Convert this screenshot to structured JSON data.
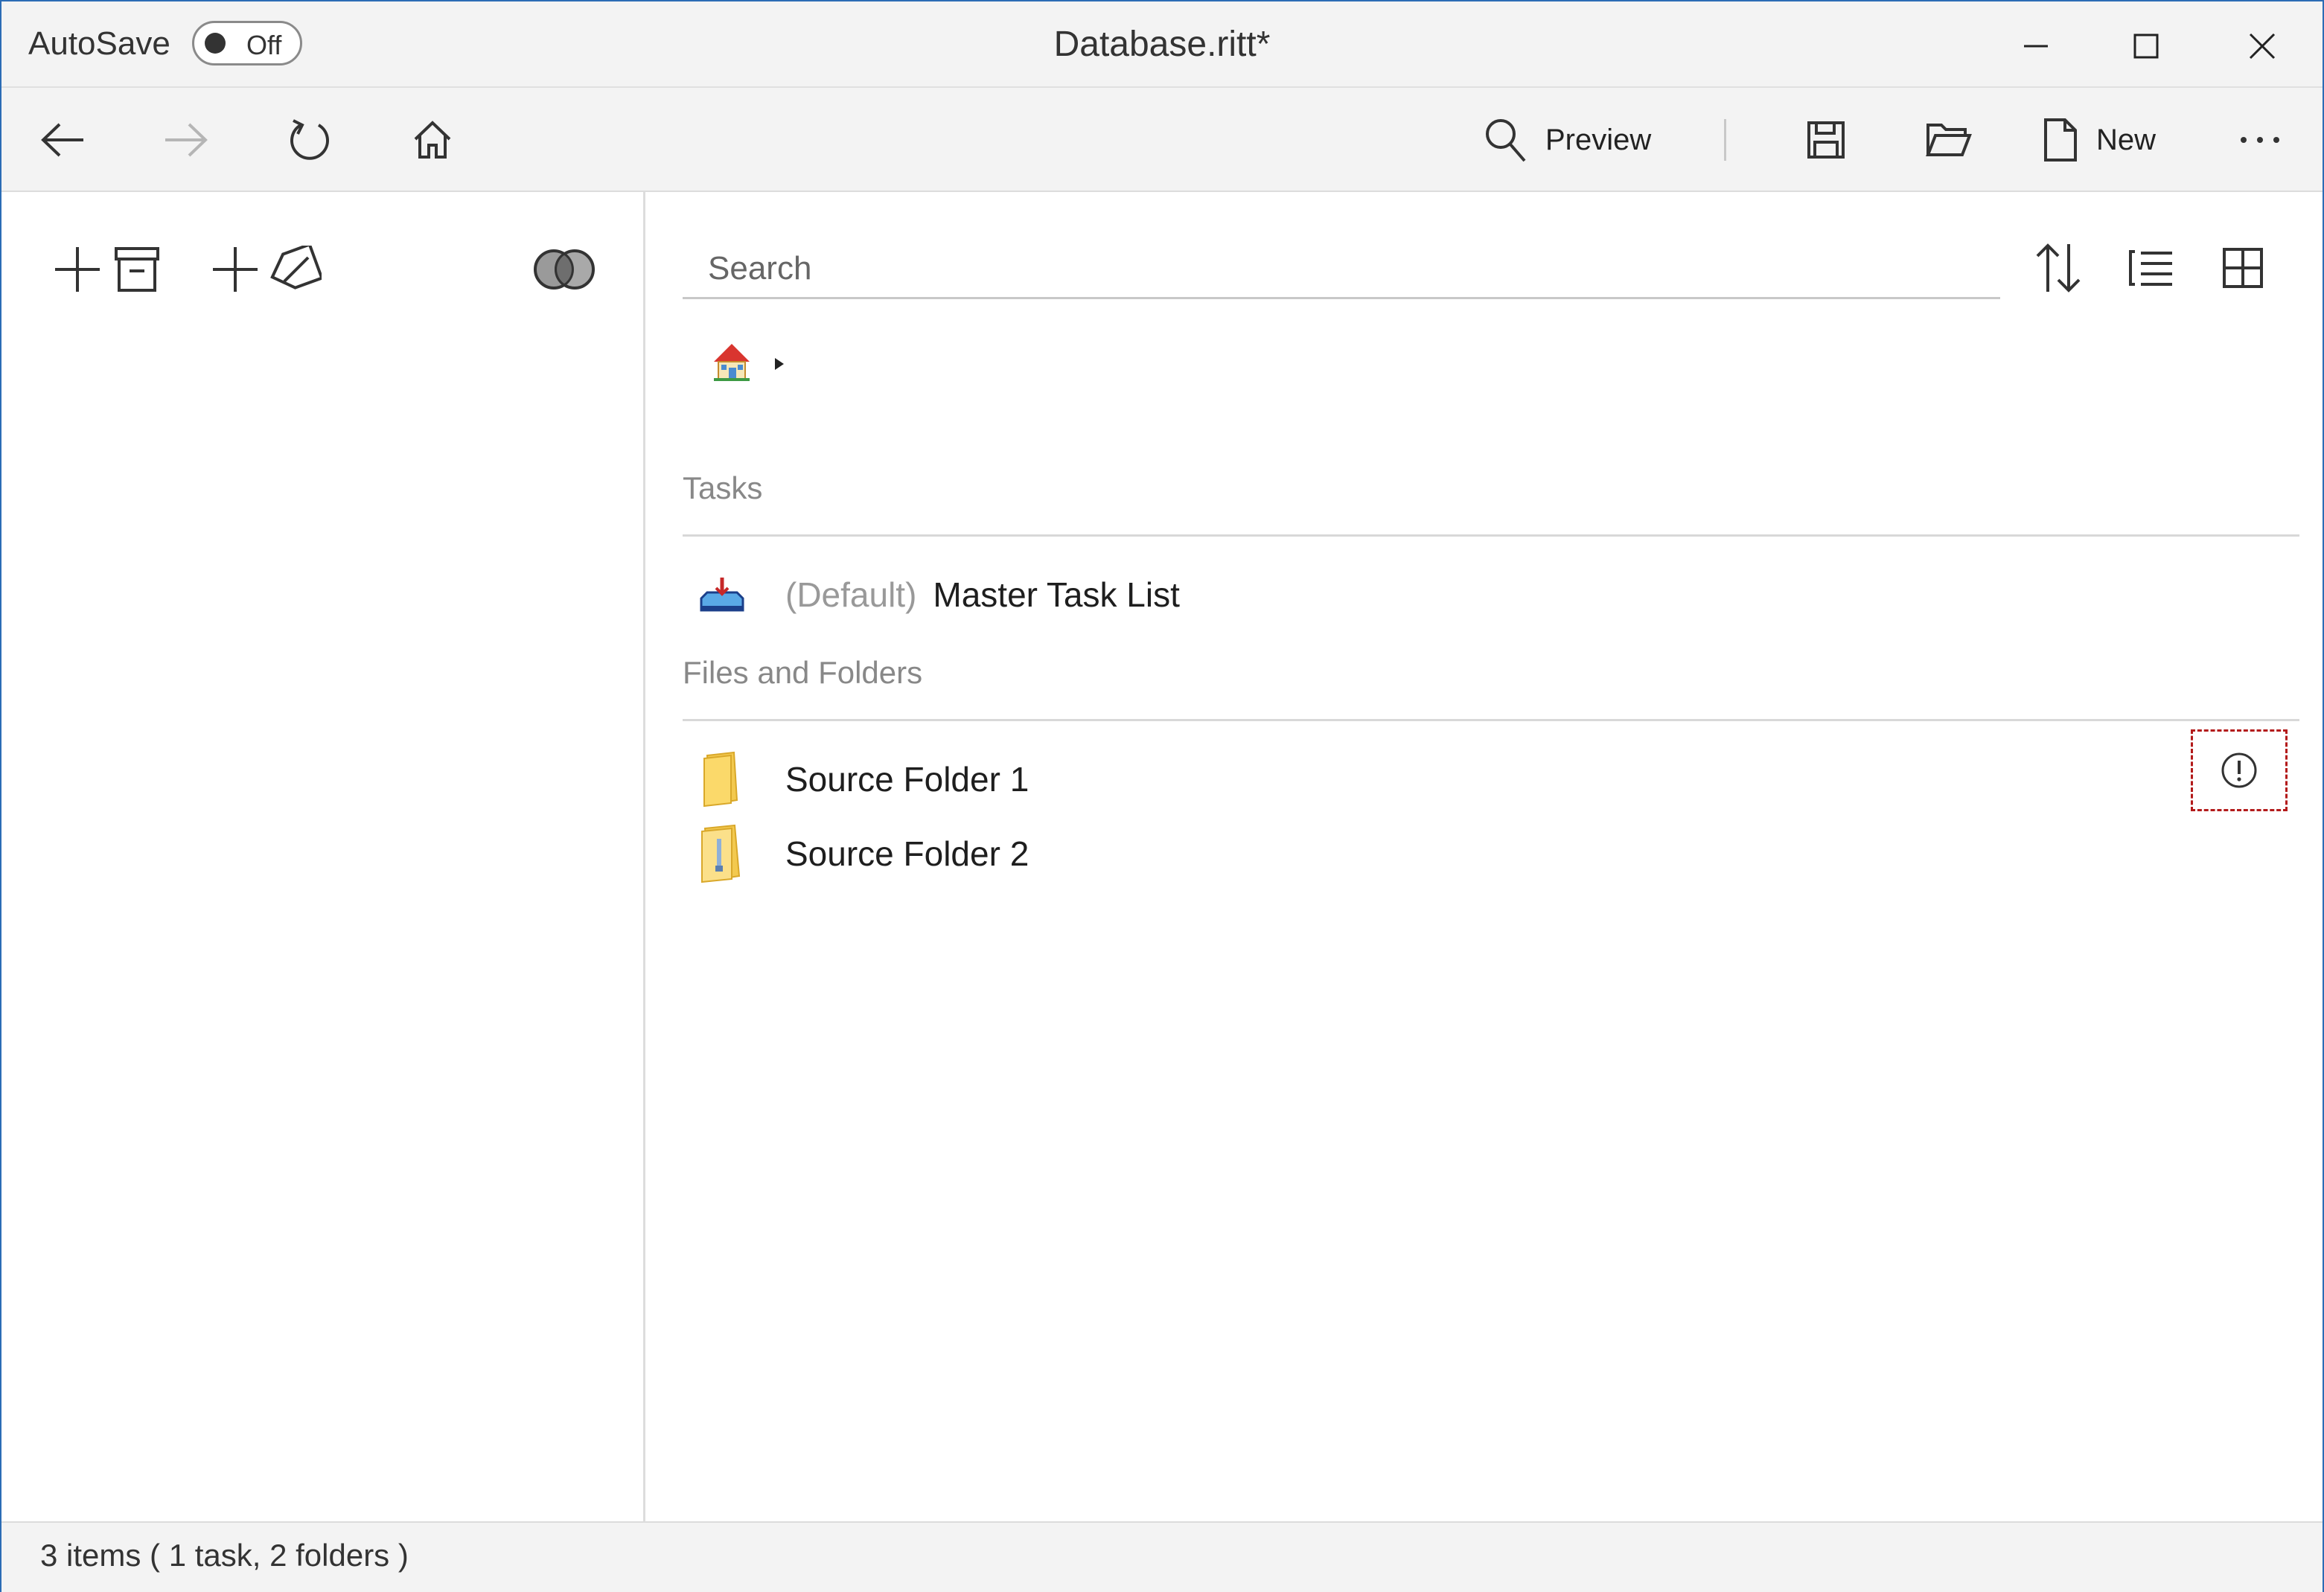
{
  "titlebar": {
    "autosave_label": "AutoSave",
    "autosave_state": "Off",
    "title": "Database.ritt*",
    "controls": [
      "minimize-icon",
      "maximize-icon",
      "close-icon"
    ]
  },
  "toolbar": {
    "nav": [
      "back-arrow-icon",
      "forward-arrow-icon",
      "refresh-icon",
      "home-icon"
    ],
    "preview_label": "Preview",
    "new_label": "New",
    "actions": [
      "search-icon",
      "save-icon",
      "open-folder-icon",
      "new-document-icon",
      "more-icon"
    ]
  },
  "left_pane": {
    "buttons": [
      "add-archive-button",
      "add-tag-button",
      "venn-merge-icon"
    ]
  },
  "main": {
    "search": {
      "placeholder": "Search",
      "value": ""
    },
    "view_icons": [
      "sort-icon",
      "list-view-icon",
      "grid-view-icon"
    ],
    "breadcrumb": {
      "root_icon": "home-color-icon"
    },
    "sections": {
      "tasks_header": "Tasks",
      "files_header": "Files and Folders"
    },
    "tasks": [
      {
        "prefix": "(Default)",
        "label": "Master Task List",
        "icon": "task-inbox-icon"
      }
    ],
    "folders": [
      {
        "label": "Source Folder 1",
        "icon": "folder-icon"
      },
      {
        "label": "Source Folder 2",
        "icon": "zip-folder-icon"
      }
    ]
  },
  "status": {
    "text": "3 items  ( 1 task, 2 folders )"
  },
  "colors": {
    "window_border": "#2b6cb5",
    "chrome_bg": "#f3f3f3",
    "focus_outline": "#b31b1b",
    "muted_text": "#888888"
  }
}
